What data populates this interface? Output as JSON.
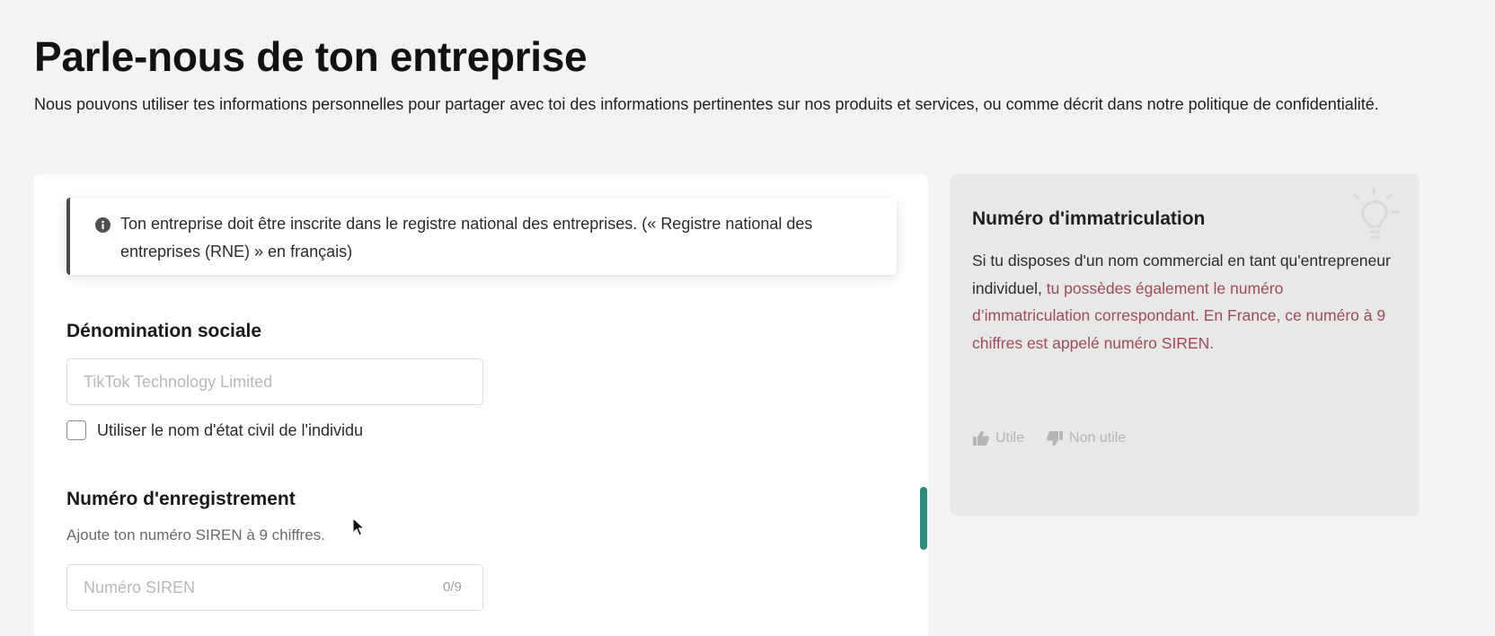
{
  "page": {
    "title": "Parle-nous de ton entreprise",
    "subtitle": "Nous pouvons utiliser tes informations personnelles pour partager avec toi des informations pertinentes sur nos produits et services, ou comme décrit dans notre politique de confidentialité."
  },
  "notice": {
    "icon": "info-icon",
    "text": "Ton entreprise doit être inscrite dans le registre national des entreprises. (« Registre national des entreprises (RNE) » en français)"
  },
  "form": {
    "denomination": {
      "label": "Dénomination sociale",
      "placeholder": "TikTok Technology Limited",
      "value": ""
    },
    "individual_checkbox": {
      "label": "Utiliser le nom d'état civil de l'individu",
      "checked": false
    },
    "registration": {
      "label": "Numéro d'enregistrement",
      "helper": "Ajoute ton numéro SIREN à 9 chiffres.",
      "placeholder": "Numéro SIREN",
      "value": "",
      "counter": "0/9"
    }
  },
  "help": {
    "icon": "lightbulb-icon",
    "title": "Numéro d'immatriculation",
    "body_plain": "Si tu disposes d'un nom commercial en tant qu'entrepreneur individuel, ",
    "body_highlight": "tu possèdes également le numéro d’immatriculation correspondant. En France, ce numéro à 9 chiffres est appelé numéro SIREN.",
    "useful_label": "Utile",
    "not_useful_label": "Non utile"
  },
  "colors": {
    "background": "#f3f3f3",
    "highlight_text": "#a14a56",
    "scroll_thumb": "#2f8c7a"
  }
}
